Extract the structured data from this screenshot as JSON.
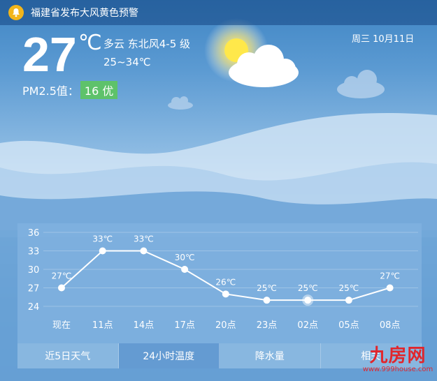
{
  "alert": {
    "icon": "bell-icon",
    "text": "福建省发布大风黄色预警"
  },
  "current": {
    "temperature": "27",
    "unit": "℃",
    "condition": "多云 东北风4-5 级",
    "range": "25~34℃",
    "date": "周三 10月11日",
    "pm_label": "PM2.5值：",
    "pm_value": "16 优",
    "weather_icon": "partly-cloudy-icon"
  },
  "tabs": [
    {
      "label": "近5日天气",
      "active": false
    },
    {
      "label": "24小时温度",
      "active": true
    },
    {
      "label": "降水量",
      "active": false
    },
    {
      "label": "相关",
      "active": false
    }
  ],
  "watermark": {
    "main": "九房网",
    "sub": "www.999house.com"
  },
  "chart_data": {
    "type": "line",
    "categories": [
      "现在",
      "11点",
      "14点",
      "17点",
      "20点",
      "23点",
      "02点",
      "05点",
      "08点"
    ],
    "values": [
      27,
      33,
      33,
      30,
      26,
      25,
      25,
      25,
      27
    ],
    "point_labels": [
      "27℃",
      "33℃",
      "33℃",
      "30℃",
      "26℃",
      "25℃",
      "25℃",
      "25℃",
      "27℃"
    ],
    "yticks": [
      36,
      33,
      30,
      27,
      24
    ],
    "ylim": [
      24,
      36
    ],
    "highlight_index": 6,
    "grid": true,
    "colors": {
      "line": "#ffffff",
      "panel": "#7fb0df"
    }
  }
}
